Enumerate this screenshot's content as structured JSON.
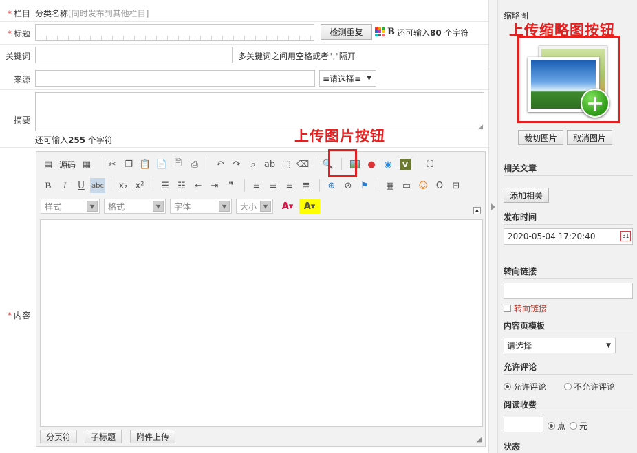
{
  "form": {
    "column": {
      "label": "栏目",
      "name": "分类名称",
      "note": "[同时发布到其他栏目]"
    },
    "title": {
      "label": "标题",
      "check_button": "检测重复",
      "bold_icon": "B",
      "remaining_prefix": "还可输入",
      "remaining_count": "80",
      "remaining_suffix": " 个字符"
    },
    "keywords": {
      "label": "关键词",
      "hint": "多关键词之间用空格或者\",\"隔开"
    },
    "source": {
      "label": "来源",
      "select_value": "≡请选择≡"
    },
    "summary": {
      "label": "摘要",
      "remaining_prefix": "还可输入",
      "remaining_count": "255",
      "remaining_suffix": " 个字符"
    },
    "content": {
      "label": "内容"
    }
  },
  "editor": {
    "source_label": "源码",
    "combos": {
      "style": "样式",
      "format": "格式",
      "font": "字体",
      "size": "大小"
    },
    "bottom_buttons": [
      "分页符",
      "子标题",
      "附件上传"
    ]
  },
  "annotations": {
    "upload_image": "上传图片按钮",
    "upload_thumb": "上传缩略图按钮"
  },
  "sidebar": {
    "thumb": {
      "title": "缩略图",
      "crop": "裁切图片",
      "cancel": "取消图片"
    },
    "related": {
      "title": "相关文章",
      "add": "添加相关"
    },
    "publish": {
      "title": "发布时间",
      "value": "2020-05-04 17:20:40",
      "cal_day": "31"
    },
    "redirect": {
      "title": "转向链接",
      "checkbox_label": "转向链接"
    },
    "template": {
      "title": "内容页模板",
      "select_value": "请选择"
    },
    "comment": {
      "title": "允许评论",
      "allow": "允许评论",
      "deny": "不允许评论"
    },
    "charge": {
      "title": "阅读收费",
      "unit_point": "点",
      "unit_yuan": "元"
    },
    "status": {
      "title": "状态"
    }
  },
  "colors": {
    "required": "#e4393c",
    "annotation": "#e61e1e",
    "link_red": "#c0392b"
  }
}
